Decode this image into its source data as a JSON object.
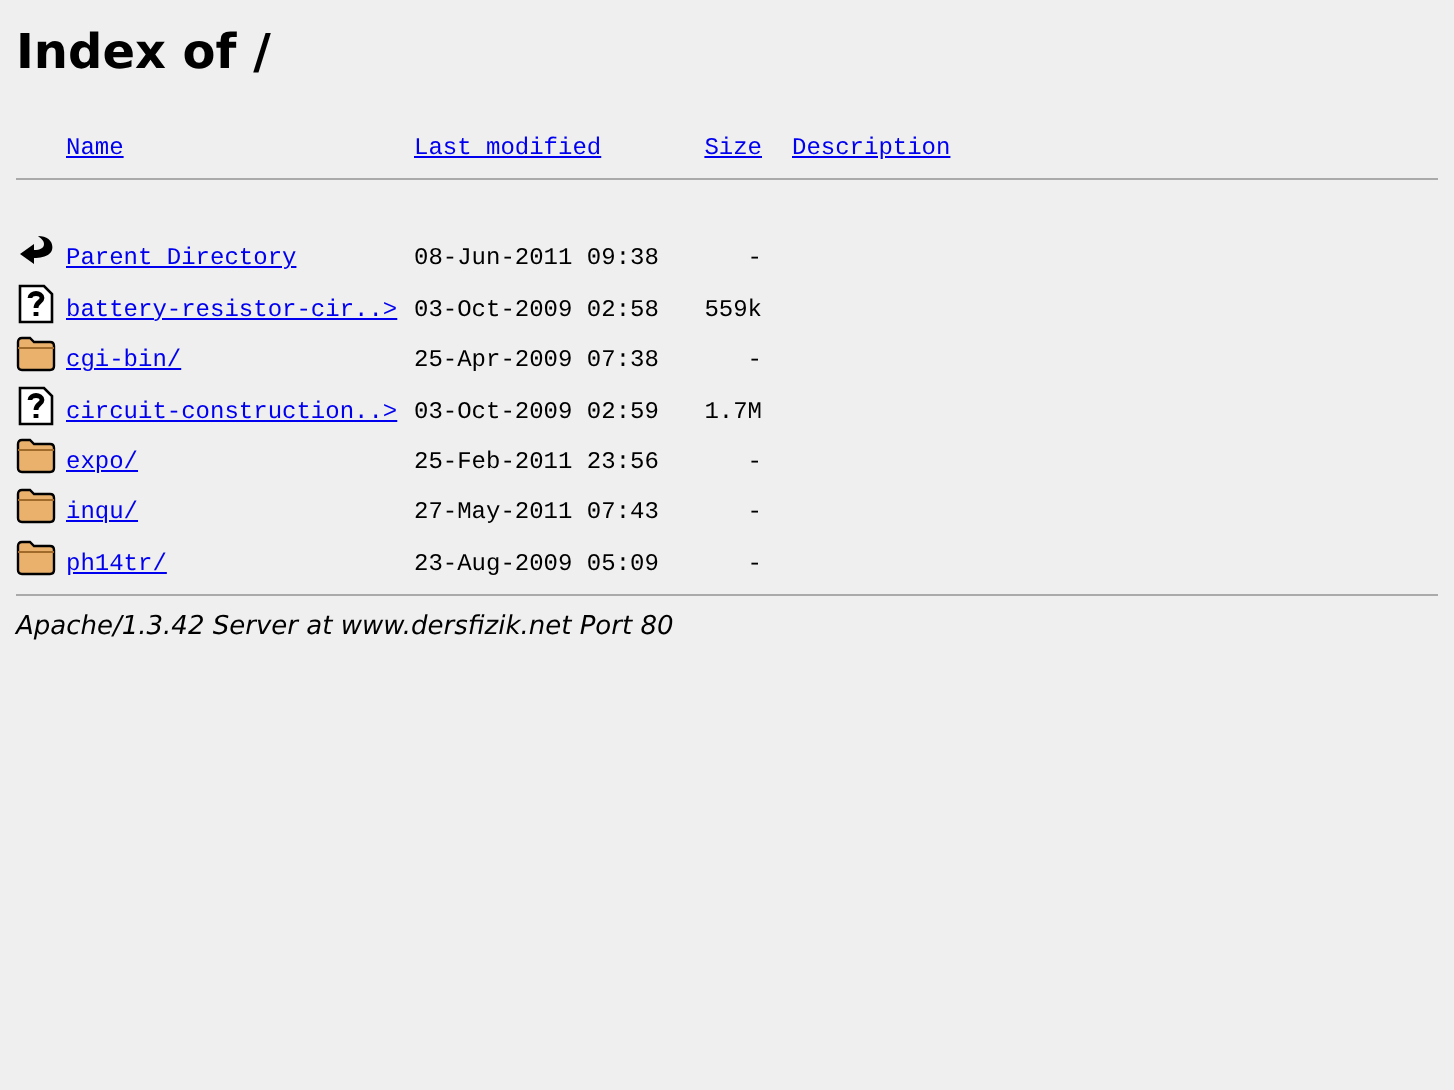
{
  "title": "Index of /",
  "columns": [
    "Name",
    "Last modified",
    "Size",
    "Description"
  ],
  "rows": [
    {
      "kind": "back",
      "name": "Parent Directory",
      "modified": "08-Jun-2011 09:38",
      "size": "-"
    },
    {
      "kind": "unknown",
      "name": "battery-resistor-cir..>",
      "modified": "03-Oct-2009 02:58",
      "size": "559k"
    },
    {
      "kind": "folder",
      "name": "cgi-bin/",
      "modified": "25-Apr-2009 07:38",
      "size": "-"
    },
    {
      "kind": "unknown",
      "name": "circuit-construction..>",
      "modified": "03-Oct-2009 02:59",
      "size": "1.7M"
    },
    {
      "kind": "folder",
      "name": "expo/",
      "modified": "25-Feb-2011 23:56",
      "size": "-"
    },
    {
      "kind": "folder",
      "name": "inqu/",
      "modified": "27-May-2011 07:43",
      "size": "-"
    },
    {
      "kind": "folder",
      "name": "ph14tr/",
      "modified": "23-Aug-2009 05:09",
      "size": "-"
    }
  ],
  "footer": "Apache/1.3.42 Server at www.dersfizik.net Port 80"
}
